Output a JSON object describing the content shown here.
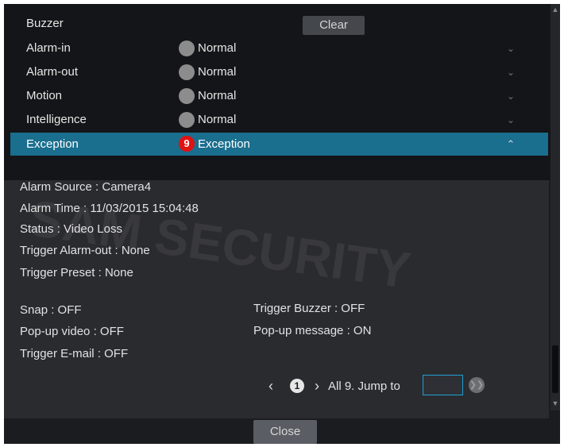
{
  "alarm_list": {
    "rows": [
      {
        "name": "Buzzer",
        "status": ""
      },
      {
        "name": "Alarm-in",
        "status": "Normal"
      },
      {
        "name": "Alarm-out",
        "status": "Normal"
      },
      {
        "name": "Motion",
        "status": "Normal"
      },
      {
        "name": "Intelligence",
        "status": "Normal"
      },
      {
        "name": "Exception",
        "status": "Exception",
        "count": "9"
      }
    ],
    "clear_label": "Clear"
  },
  "details": {
    "alarm_source": "Alarm Source : Camera4",
    "alarm_time": "Alarm Time : 11/03/2015 15:04:48",
    "status": "Status : Video Loss",
    "trigger_alarm_out": "Trigger Alarm-out : None",
    "trigger_preset": "Trigger Preset : None",
    "snap": "Snap : OFF",
    "popup_video": "Pop-up video : OFF",
    "trigger_email": "Trigger E-mail : OFF",
    "trigger_buzzer": "Trigger Buzzer : OFF",
    "popup_message": "Pop-up message : ON"
  },
  "pager": {
    "current_page": "1",
    "summary": "All 9. Jump to",
    "jump_value": ""
  },
  "footer": {
    "close_label": "Close"
  },
  "watermark": "SAM SECURITY",
  "colors": {
    "active_row": "#1a6e8e",
    "badge": "#e01212",
    "jump_border": "#1f9fd0"
  }
}
